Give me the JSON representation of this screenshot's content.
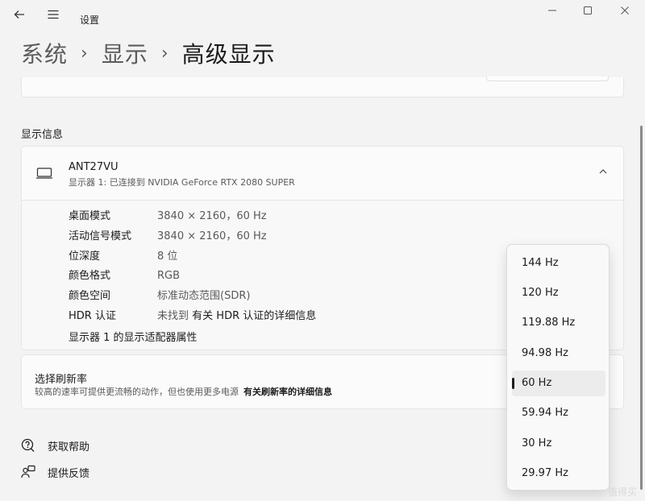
{
  "titlebar": {
    "app_title": "设置",
    "back_icon": "back-arrow-icon",
    "menu_icon": "hamburger-menu-icon",
    "minimize_glyph": "—",
    "maximize_glyph": "☐",
    "close_glyph": "✕"
  },
  "breadcrumb": {
    "items": [
      "系统",
      "显示",
      "高级显示"
    ],
    "separator": "›"
  },
  "display_info": {
    "section_title": "显示信息",
    "monitor": {
      "name": "ANT27VU",
      "subtitle": "显示器 1: 已连接到 NVIDIA GeForce RTX 2080 SUPER",
      "icon": "monitor-icon",
      "collapse_glyph": "∧"
    },
    "rows": [
      {
        "key": "桌面模式",
        "value": "3840 × 2160，60 Hz"
      },
      {
        "key": "活动信号模式",
        "value": "3840 × 2160，60 Hz"
      },
      {
        "key": "位深度",
        "value": "8 位"
      },
      {
        "key": "颜色格式",
        "value": "RGB"
      },
      {
        "key": "颜色空间",
        "value": "标准动态范围(SDR)"
      },
      {
        "key": "HDR 认证",
        "value": "未找到",
        "link": "有关 HDR 认证的详细信息"
      }
    ],
    "adapter_link": "显示器 1 的显示适配器属性"
  },
  "refresh_rate": {
    "title": "选择刷新率",
    "description": "较高的速率可提供更流畅的动作，但也使用更多电源",
    "link": "有关刷新率的详细信息",
    "options": [
      "144 Hz",
      "120 Hz",
      "119.88 Hz",
      "94.98 Hz",
      "60 Hz",
      "59.94 Hz",
      "30 Hz",
      "29.97 Hz"
    ],
    "selected": "60 Hz"
  },
  "footer_links": {
    "help": "获取帮助",
    "feedback": "提供反馈"
  },
  "watermark": "值得买"
}
